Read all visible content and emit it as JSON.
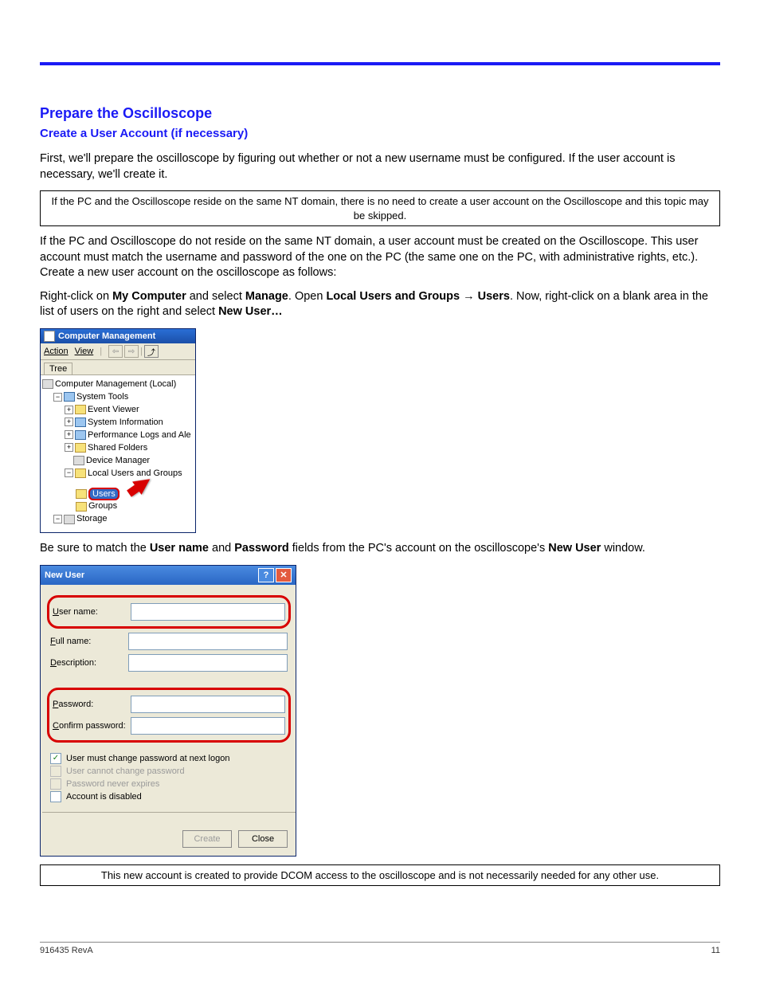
{
  "section_title": "Prepare the Oscilloscope",
  "sub_title": "Create a User Account (if necessary)",
  "para1": "First, we'll prepare the oscilloscope by figuring out whether or not a new username must be configured. If the user account is necessary, we'll create it.",
  "note1": "If the PC and the Oscilloscope reside on the same NT domain, there is no need to create a user account on the Oscilloscope and this topic may be skipped.",
  "para2": "If the PC and Oscilloscope do not reside on the same NT domain, a user account must be created on the Oscilloscope. This user account must match the username and password of the one on the PC (the same one on the PC, with administrative rights, etc.). Create a new user account on the oscilloscope as follows:",
  "instr": {
    "p1": "Right-click on ",
    "b1": "My Computer",
    "p2": " and select ",
    "b2": "Manage",
    "p3": ". Open ",
    "b3": "Local Users and Groups",
    "arrow": " → ",
    "b4": "Users",
    "p4": ". Now, right-click on a blank area in the list of users on the right and select ",
    "b5": "New User…"
  },
  "cm": {
    "title": "Computer Management",
    "menu_action": "Action",
    "menu_view": "View",
    "tab_tree": "Tree",
    "root": "Computer Management (Local)",
    "n_systools": "System Tools",
    "n_ev": "Event Viewer",
    "n_si": "System Information",
    "n_perf": "Performance Logs and Ale",
    "n_sf": "Shared Folders",
    "n_dm": "Device Manager",
    "n_lug": "Local Users and Groups",
    "n_users": "Users",
    "n_groups": "Groups",
    "n_storage": "Storage"
  },
  "para3a": "Be sure to match the ",
  "para3b": "User name",
  "para3c": " and ",
  "para3d": "Password",
  "para3e": " fields from the PC's account on the oscilloscope's ",
  "para3f": "New User",
  "para3g": " window.",
  "nu": {
    "title": "New User",
    "f_user": "User name:",
    "f_full": "Full name:",
    "f_desc": "Description:",
    "f_pass": "Password:",
    "f_cpass": "Confirm password:",
    "c1": "User must change password at next logon",
    "c2": "User cannot change password",
    "c3": "Password never expires",
    "c4": "Account is disabled",
    "btn_create": "Create",
    "btn_close": "Close"
  },
  "note2": "This new account is created to provide DCOM access to the oscilloscope and is not necessarily needed for any other use.",
  "footer_left": "916435 RevA",
  "footer_right": "11"
}
